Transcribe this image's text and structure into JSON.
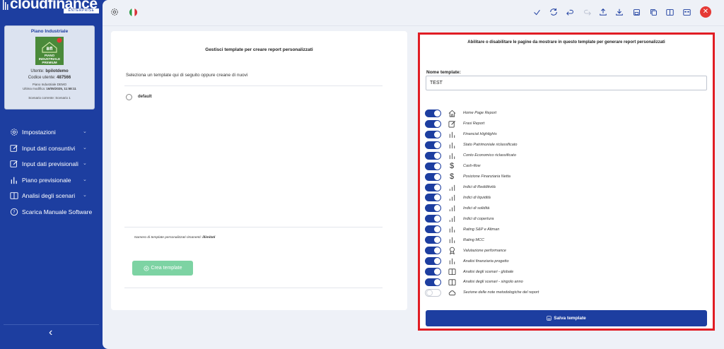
{
  "brand": {
    "logo_text": "cloudfinance",
    "edition": "ENTERPRISE"
  },
  "profile": {
    "plan_title": "Piano Industriale",
    "badge_line1": "PIANO",
    "badge_line2": "INDUSTRIALE",
    "badge_line3": "PREMIUM",
    "user_label": "Utente:",
    "user_value": "bpilotdemo",
    "code_label": "Codice utente:",
    "code_value": "487566",
    "plan_name": "Piano Industriale DEMO",
    "last_modified_label": "Ultima modifica:",
    "last_modified_value": "16/05/2025, 11:58:11",
    "scenario": "Scenario corrente: Scenario 1"
  },
  "sidebar": {
    "items": [
      {
        "label": "Impostazioni",
        "icon": "gear-icon",
        "chevron": true
      },
      {
        "label": "Input dati consuntivi",
        "icon": "edit-icon",
        "chevron": true
      },
      {
        "label": "Input dati previsionali",
        "icon": "edit-icon",
        "chevron": true
      },
      {
        "label": "Piano previsionale",
        "icon": "bar-chart-icon",
        "chevron": true
      },
      {
        "label": "Analisi degli scenari",
        "icon": "columns-icon",
        "chevron": true
      },
      {
        "label": "Scarica Manuale Software",
        "icon": "help-circle-icon",
        "chevron": false
      }
    ],
    "collapse_glyph": "‹"
  },
  "topbar": {
    "icons": [
      "check-icon",
      "refresh-icon",
      "undo-icon",
      "redo-icon",
      "upload-icon",
      "download-icon",
      "save-icon",
      "copy-icon",
      "columns-icon",
      "calendar-icon",
      "close-icon"
    ],
    "close_glyph": "✕"
  },
  "left_panel": {
    "title": "Gestisci template per creare report personalizzati",
    "subtitle": "Seleziona un template qui di seguito oppure creane di nuovi",
    "templates": [
      "default"
    ],
    "remaining_label": "Numero di template personalizzati rimanenti:",
    "remaining_value": "illimitati",
    "create_button": "Crea template"
  },
  "right_panel": {
    "title": "Abilitare o disabilitare le pagine da mostrare in questo template per generare report personalizzati",
    "name_label": "Nome template:",
    "name_value": "TEST",
    "pages": [
      {
        "label": "Home Page Report",
        "icon": "home-icon",
        "enabled": true
      },
      {
        "label": "Frasi Report",
        "icon": "edit-icon",
        "enabled": true
      },
      {
        "label": "Financial Highlights",
        "icon": "bar-chart-icon",
        "enabled": true
      },
      {
        "label": "Stato Patrimoniale riclassificato",
        "icon": "bar-chart-icon",
        "enabled": true
      },
      {
        "label": "Conto Economico riclassificato",
        "icon": "bar-chart-icon",
        "enabled": true
      },
      {
        "label": "Cash-flow",
        "icon": "dollar-icon",
        "enabled": true
      },
      {
        "label": "Posizione Finanziaria Netta",
        "icon": "dollar-icon",
        "enabled": true
      },
      {
        "label": "Indici di Redditività",
        "icon": "bar-chart-up-icon",
        "enabled": true
      },
      {
        "label": "Indici di liquidità",
        "icon": "bar-chart-up-icon",
        "enabled": true
      },
      {
        "label": "Indici di solidità",
        "icon": "bar-chart-up-icon",
        "enabled": true
      },
      {
        "label": "Indici di copertura",
        "icon": "bar-chart-up-icon",
        "enabled": true
      },
      {
        "label": "Rating S&P e Altman",
        "icon": "bar-chart-icon",
        "enabled": true
      },
      {
        "label": "Rating MCC",
        "icon": "bar-chart-icon",
        "enabled": true
      },
      {
        "label": "Valutazione performance",
        "icon": "award-icon",
        "enabled": true
      },
      {
        "label": "Analisi finanziaria progetto",
        "icon": "bar-chart-icon",
        "enabled": true
      },
      {
        "label": "Analisi degli scenari - globale",
        "icon": "columns-icon",
        "enabled": true
      },
      {
        "label": "Analisi degli scenari - singolo anno",
        "icon": "columns-icon",
        "enabled": true
      },
      {
        "label": "Sezione delle note metodologiche del report",
        "icon": "cloud-icon",
        "enabled": false
      }
    ],
    "save_button": "Salva template"
  },
  "colors": {
    "brand": "#1d3ea0",
    "highlight": "#e11d24",
    "create_button": "#7dd3a3",
    "close": "#e53935"
  }
}
